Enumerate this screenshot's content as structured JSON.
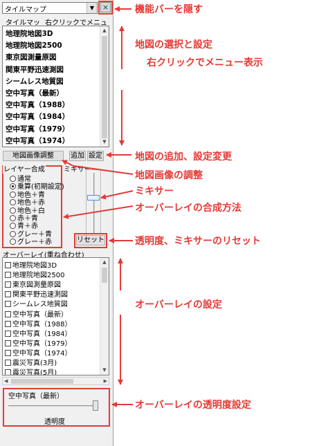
{
  "panel": {
    "map_combo": "タイルマップ",
    "close_glyph": "×",
    "menu_left": "タイルマップ",
    "menu_right": "右クリックでメニュー",
    "map_list": [
      "地理院地図3D",
      "地理院地図2500",
      "東京図測量原図",
      "関東平野迅速測図",
      "シームレス地質図",
      "空中写真（最新）",
      "空中写真（1988）",
      "空中写真（1984）",
      "空中写真（1979）",
      "空中写真（1974）"
    ],
    "btn_adjust": "地図画像調整",
    "btn_add": "追加",
    "btn_settings": "設定",
    "blend_title": "レイヤー合成",
    "blend_modes": [
      "通常",
      "乗算(初期設定)",
      "地色＋青",
      "地色＋赤",
      "地色＋白",
      "赤＋青",
      "青＋赤",
      "グレー＋青",
      "グレー＋赤"
    ],
    "blend_selected_index": 1,
    "mixer_label": "ミキサー",
    "btn_reset": "リセット",
    "overlay_title": "オーバーレイ(重ね合わせ)",
    "overlay_list": [
      "地理院地図3D",
      "地理院地図2500",
      "東京図測量原図",
      "関東平野迅速測図",
      "シームレス地質図",
      "空中写真（最新）",
      "空中写真（1988）",
      "空中写真（1984）",
      "空中写真（1979）",
      "空中写真（1974）",
      "震災写真(3月)",
      "震災写真(5月)"
    ],
    "transparency_layer": "空中写真（最新）",
    "transparency_label": "透明度"
  },
  "annotations": {
    "hide_bar": "機能バーを隠す",
    "map_select_1": "地図の選択と設定",
    "map_select_2": "右クリックでメニュー表示",
    "add_settings": "地図の追加、設定変更",
    "image_adjust": "地図画像の調整",
    "mixer": "ミキサー",
    "blend_method": "オーバーレイの合成方法",
    "reset": "透明度、ミキサーのリセット",
    "overlay_settings": "オーバーレイの設定",
    "overlay_transparency": "オーバーレイの透明度設定"
  },
  "colors": {
    "accent": "#e53935"
  }
}
